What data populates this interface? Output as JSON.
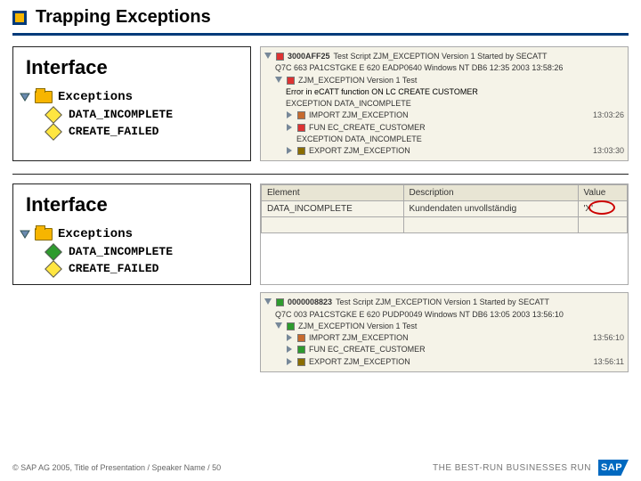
{
  "title": "Trapping Exceptions",
  "panel": {
    "heading": "Interface",
    "root": "Exceptions",
    "ex1": "DATA_INCOMPLETE",
    "ex2": "CREATE_FAILED"
  },
  "log1": {
    "header_id": "3000AFF25",
    "header_text": "Test Script ZJM_EXCEPTION Version 1 Started by SECATT",
    "env": "Q7C 663 PA1CSTGKE E 620 EADP0640 Windows NT DB6 12:35 2003 13:58:26",
    "node": "ZJM_EXCEPTION  Version 1  Test",
    "err": "Error in eCATT function   ON LC CREATE CUSTOMER",
    "exc1": "EXCEPTION DATA_INCOMPLETE",
    "imp": "IMPORT  ZJM_EXCEPTION",
    "imp_time": "13:03:26",
    "fun": "FUN     EC_CREATE_CUSTOMER",
    "exc2": "EXCEPTION DATA_INCOMPLETE",
    "exp": "EXPORT  ZJM_EXCEPTION",
    "exp_time": "13:03:30"
  },
  "table": {
    "h1": "Element",
    "h2": "Description",
    "h3": "Value",
    "r1c1": "DATA_INCOMPLETE",
    "r1c2": "Kundendaten unvollständig",
    "r1c3": "'X'"
  },
  "log2": {
    "header_id": "0000008823",
    "header_text": "Test Script ZJM_EXCEPTION Version 1 Started by SECATT",
    "env": "Q7C 003 PA1CSTGKE E 620 PUDP0049 Windows NT DB6 13:05 2003 13:56:10",
    "node": "ZJM_EXCEPTION  Version 1  Test",
    "imp": "IMPORT  ZJM_EXCEPTION",
    "imp_time": "13:56:10",
    "fun": "FUN     EC_CREATE_CUSTOMER",
    "exp": "EXPORT  ZJM_EXCEPTION",
    "exp_time": "13:56:11"
  },
  "footer": {
    "copyright": "© SAP AG 2005, Title of Presentation / Speaker Name / 50",
    "tagline": "THE BEST-RUN BUSINESSES RUN",
    "logo": "SAP"
  }
}
